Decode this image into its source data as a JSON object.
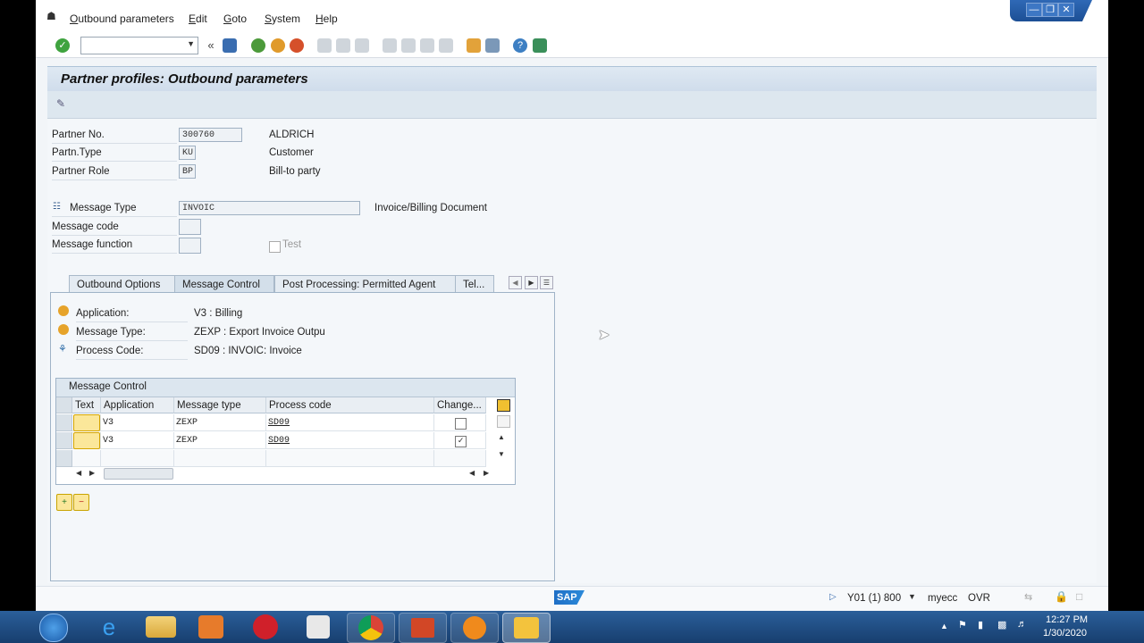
{
  "menu": {
    "items": [
      "Outbound parameters",
      "Edit",
      "Goto",
      "System",
      "Help"
    ]
  },
  "page": {
    "title": "Partner profiles: Outbound parameters"
  },
  "partner": {
    "no_label": "Partner No.",
    "no_value": "300760",
    "no_desc": "ALDRICH",
    "type_label": "Partn.Type",
    "type_value": "KU",
    "type_desc": "Customer",
    "role_label": "Partner Role",
    "role_value": "BP",
    "role_desc": "Bill-to party"
  },
  "message": {
    "type_label": "Message Type",
    "type_value": "INVOIC",
    "type_desc": "Invoice/Billing Document",
    "code_label": "Message code",
    "function_label": "Message function",
    "test_label": "Test"
  },
  "tabs": [
    "Outbound Options",
    "Message Control",
    "Post Processing: Permitted Agent",
    "Tel..."
  ],
  "active_tab": "Message Control",
  "control": {
    "app_label": "Application:",
    "app_value": "V3 : Billing",
    "msgtype_label": "Message Type:",
    "msgtype_value": "ZEXP : Export Invoice Outpu",
    "proc_label": "Process Code:",
    "proc_value": "SD09 : INVOIC: Invoice"
  },
  "grid": {
    "title": "Message Control",
    "columns": [
      "Text",
      "Application",
      "Message type",
      "Process code",
      "Change..."
    ],
    "rows": [
      {
        "application": "V3",
        "message_type": "ZEXP",
        "process_code": "SD09",
        "change": false
      },
      {
        "application": "V3",
        "message_type": "ZEXP",
        "process_code": "SD09",
        "change": true
      }
    ]
  },
  "status": {
    "system": "Y01 (1) 800",
    "server": "myecc",
    "mode": "OVR",
    "logo": "SAP"
  },
  "taskbar": {
    "time": "12:27 PM",
    "date": "1/30/2020"
  },
  "colors": {
    "accent": "#2f69b6",
    "title_bg": "#dfe9f3",
    "taskbar": "#1f4d85"
  }
}
